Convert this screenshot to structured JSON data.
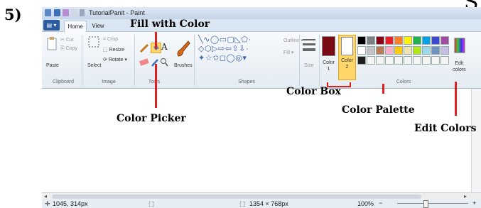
{
  "step_number": "5)",
  "corner_text": "S",
  "window": {
    "title": "TutorialPanit - Paint",
    "menu_label": "▤ ▾",
    "tabs": [
      {
        "label": "Home",
        "active": true
      },
      {
        "label": "View",
        "active": false
      }
    ]
  },
  "ribbon": {
    "clipboard": {
      "paste": "Paste",
      "cut": "Cut",
      "copy": "Copy",
      "group": "Clipboard"
    },
    "image": {
      "select": "Select",
      "crop": "Crop",
      "resize": "Resize",
      "rotate": "Rotate ▾",
      "group": "Image"
    },
    "tools": {
      "text_tool": "A",
      "group": "Tools"
    },
    "brushes": {
      "label": "Brushes"
    },
    "shapes": {
      "outline": "Outline ▾",
      "fill": "Fill ▾",
      "group": "Shapes"
    },
    "size": {
      "label": "Size"
    },
    "colors": {
      "color1_label": "Color\n1",
      "color2_label": "Color\n2",
      "edit_colors": "Edit\ncolors",
      "group": "Colors",
      "color1_value": "#7a0b14",
      "color2_value": "#ffffff",
      "palette_row1": [
        "#000000",
        "#7f7f7f",
        "#880015",
        "#ed1c24",
        "#ff7f27",
        "#fff200",
        "#22b14c",
        "#00a2e8",
        "#3f48cc",
        "#a349a4"
      ],
      "palette_row2": [
        "#ffffff",
        "#c3c3c3",
        "#b97a57",
        "#ffaec9",
        "#ffc90e",
        "#efe4b0",
        "#b5e61d",
        "#99d9ea",
        "#7092be",
        "#c8bfe7"
      ],
      "palette_row3": [
        "#1f1f1f",
        "#f5f5f5",
        "#f5f5f5",
        "#f5f5f5",
        "#f5f5f5",
        "#f5f5f5",
        "#f5f5f5",
        "#f5f5f5",
        "#f5f5f5",
        "#f5f5f5"
      ]
    }
  },
  "status": {
    "cursor_pos": "1045, 314px",
    "image_size": "1354 × 768px",
    "zoom": "100%",
    "zoom_out": "−",
    "zoom_in": "+"
  },
  "annotations": {
    "fill_with_color": "Fill with Color",
    "color_picker": "Color Picker",
    "color_box": "Color Box",
    "color_palette": "Color Palette",
    "edit_colors": "Edit Colors"
  }
}
